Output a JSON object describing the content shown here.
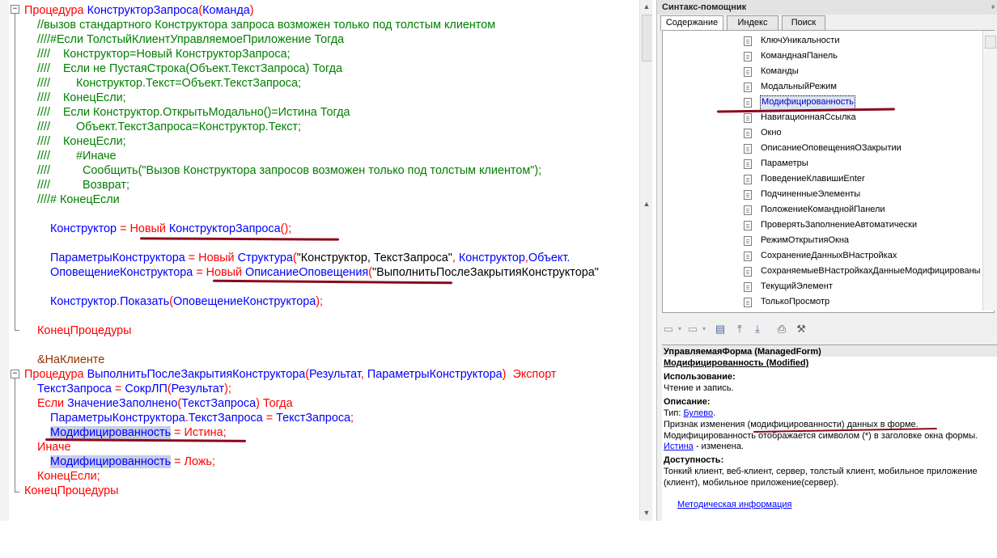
{
  "editor": {
    "lines": [
      [
        [
          "kw",
          "Процедура "
        ],
        [
          "id",
          "КонструкторЗапроса"
        ],
        [
          "op",
          "("
        ],
        [
          "id",
          "Команда"
        ],
        [
          "op",
          ")"
        ]
      ],
      [
        [
          "cm",
          "//вызов стандартного Конструктора запроса возможен только под толстым клиентом"
        ]
      ],
      [
        [
          "cm",
          "////#Если ТолстыйКлиентУправляемоеПриложение Тогда"
        ]
      ],
      [
        [
          "cm",
          "////    Конструктор=Новый КонструкторЗапроса;"
        ]
      ],
      [
        [
          "cm",
          "////    Если не ПустаяСтрока(Объект.ТекстЗапроса) Тогда"
        ]
      ],
      [
        [
          "cm",
          "////        Конструктор.Текст=Объект.ТекстЗапроса;"
        ]
      ],
      [
        [
          "cm",
          "////    КонецЕсли;"
        ]
      ],
      [
        [
          "cm",
          "////    Если Конструктор.ОткрытьМодально()=Истина Тогда"
        ]
      ],
      [
        [
          "cm",
          "////        Объект.ТекстЗапроса=Конструктор.Текст;"
        ]
      ],
      [
        [
          "cm",
          "////    КонецЕсли;"
        ]
      ],
      [
        [
          "cm",
          "////        #Иначе"
        ]
      ],
      [
        [
          "cm",
          "////          Сообщить(\"Вызов Конструктора запросов возможен только под толстым клиентом\");"
        ]
      ],
      [
        [
          "cm",
          "////          Возврат;"
        ]
      ],
      [
        [
          "cm",
          "////# КонецЕсли"
        ]
      ],
      [],
      [
        [
          "id",
          "Конструктор "
        ],
        [
          "op",
          "= "
        ],
        [
          "kw",
          "Новый "
        ],
        [
          "id",
          "КонструкторЗапроса"
        ],
        [
          "op",
          "();"
        ]
      ],
      [],
      [
        [
          "id",
          "ПараметрыКонструктора "
        ],
        [
          "op",
          "= "
        ],
        [
          "kw",
          "Новый "
        ],
        [
          "id",
          "Структура"
        ],
        [
          "op",
          "("
        ],
        [
          "st",
          "\"Конструктор, ТекстЗапроса\""
        ],
        [
          "op",
          ", "
        ],
        [
          "id",
          "Конструктор"
        ],
        [
          "op",
          ","
        ],
        [
          "id",
          "Объект."
        ]
      ],
      [
        [
          "id",
          "ОповещениеКонструктора "
        ],
        [
          "op",
          "= "
        ],
        [
          "kw",
          "Новый "
        ],
        [
          "id",
          "ОписаниеОповещения"
        ],
        [
          "op",
          "("
        ],
        [
          "st",
          "\"ВыполнитьПослеЗакрытияКонструктора\""
        ]
      ],
      [],
      [
        [
          "id",
          "Конструктор"
        ],
        [
          "op",
          "."
        ],
        [
          "id",
          "Показать"
        ],
        [
          "op",
          "("
        ],
        [
          "id",
          "ОповещениеКонструктора"
        ],
        [
          "op",
          ");"
        ]
      ],
      [],
      [
        [
          "kw",
          "КонецПроцедуры"
        ]
      ],
      [],
      [
        [
          "pp",
          "&НаКлиенте"
        ]
      ],
      [
        [
          "kw",
          "Процедура "
        ],
        [
          "id",
          "ВыполнитьПослеЗакрытияКонструктора"
        ],
        [
          "op",
          "("
        ],
        [
          "id",
          "Результат"
        ],
        [
          "op",
          ", "
        ],
        [
          "id",
          "ПараметрыКонструктора"
        ],
        [
          "op",
          ")  "
        ],
        [
          "kw",
          "Экспорт"
        ]
      ],
      [
        [
          "id",
          "ТекстЗапроса "
        ],
        [
          "op",
          "= "
        ],
        [
          "id",
          "СокрЛП"
        ],
        [
          "op",
          "("
        ],
        [
          "id",
          "Результат"
        ],
        [
          "op",
          ");"
        ]
      ],
      [
        [
          "kw",
          "Если "
        ],
        [
          "id",
          "ЗначениеЗаполнено"
        ],
        [
          "op",
          "("
        ],
        [
          "id",
          "ТекстЗапроса"
        ],
        [
          "op",
          ") "
        ],
        [
          "kw",
          "Тогда"
        ]
      ],
      [
        [
          "id",
          "ПараметрыКонструктора"
        ],
        [
          "op",
          "."
        ],
        [
          "id",
          "ТекстЗапроса "
        ],
        [
          "op",
          "= "
        ],
        [
          "id",
          "ТекстЗапроса"
        ],
        [
          "op",
          ";"
        ]
      ],
      [
        [
          "hl",
          "Модифицированность"
        ],
        [
          "op",
          " = "
        ],
        [
          "kw",
          "Истина"
        ],
        [
          "op",
          ";"
        ]
      ],
      [
        [
          "kw",
          "Иначе"
        ]
      ],
      [
        [
          "hl",
          "Модифицированность"
        ],
        [
          "op",
          " = "
        ],
        [
          "kw",
          "Ложь"
        ],
        [
          "op",
          ";"
        ]
      ],
      [
        [
          "kw",
          "КонецЕсли"
        ],
        [
          "op",
          ";"
        ]
      ],
      [
        [
          "kw",
          "КонецПроцедуры"
        ]
      ]
    ]
  },
  "helper": {
    "title": "Синтакс-помощник",
    "pin": "ᵖ",
    "tabs": [
      "Содержание",
      "Индекс",
      "Поиск"
    ],
    "tree_items": [
      "КлючУникальности",
      "КоманднаяПанель",
      "Команды",
      "МодальныйРежим",
      "Модифицированность",
      "НавигационнаяСсылка",
      "Окно",
      "ОписаниеОповещенияОЗакрытии",
      "Параметры",
      "ПоведениеКлавишиEnter",
      "ПодчиненныеЭлементы",
      "ПоложениеКоманднойПанели",
      "ПроверятьЗаполнениеАвтоматически",
      "РежимОткрытияОкна",
      "СохранениеДанныхВНастройках",
      "СохраняемыеВНастройкахДанныеМодифицированы",
      "ТекущийЭлемент",
      "ТолькоПросмотр"
    ],
    "selected_index": 4,
    "desc": {
      "header": "УправляемаяФорма (ManagedForm)",
      "name": "Модифицированность (Modified)",
      "usage_label": "Использование:",
      "usage": "Чтение и запись.",
      "description_label": "Описание:",
      "type_prefix": "Тип: ",
      "type_link": "Булево",
      "type_suffix": ".",
      "line1": "Признак изменения (модифицированности) данных в форме.",
      "line2": "Модифицированность отображается символом (*) в заголовке окна формы.",
      "line3_link": "Истина",
      "line3_rest": " - изменена.",
      "availability_label": "Доступность:",
      "availability1": "Тонкий клиент, веб-клиент, сервер, толстый клиент, мобильное приложение",
      "availability2": "(клиент), мобильное приложение(сервер).",
      "method_link": "Методическая информация"
    }
  }
}
